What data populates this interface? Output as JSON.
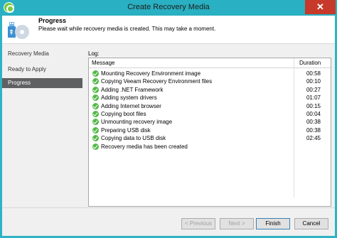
{
  "window": {
    "title": "Create Recovery Media",
    "close_glyph": "✕"
  },
  "header": {
    "title": "Progress",
    "subtitle": "Please wait while recovery media is created. This may take a moment."
  },
  "nav": {
    "items": [
      {
        "label": "Recovery Media",
        "active": false
      },
      {
        "label": "Ready to Apply",
        "active": false
      },
      {
        "label": "Progress",
        "active": true
      }
    ]
  },
  "log": {
    "label": "Log:",
    "columns": {
      "message": "Message",
      "duration": "Duration"
    },
    "rows": [
      {
        "message": "Mounting Recovery Environment image",
        "duration": "00:58"
      },
      {
        "message": "Copying Veeam Recovery Environment files",
        "duration": "00:10"
      },
      {
        "message": "Adding .NET Framework",
        "duration": "00:27"
      },
      {
        "message": "Adding system drivers",
        "duration": "01:07"
      },
      {
        "message": "Adding Internet browser",
        "duration": "00:15"
      },
      {
        "message": "Copying boot files",
        "duration": "00:04"
      },
      {
        "message": "Unmounting recovery image",
        "duration": "00:38"
      },
      {
        "message": "Preparing USB disk",
        "duration": "00:38"
      },
      {
        "message": "Copying data to USB disk",
        "duration": "02:45"
      },
      {
        "message": "Recovery media has been created",
        "duration": ""
      }
    ]
  },
  "footer": {
    "previous": "< Previous",
    "next": "Next >",
    "finish": "Finish",
    "cancel": "Cancel"
  },
  "colors": {
    "titlebar": "#29b0c2",
    "nav_active": "#5e6061",
    "status_ok": "#54b948",
    "close": "#c7392a"
  },
  "icons": {
    "status": "check-circle-icon",
    "header": "usb-drive-icon",
    "app": "veeam-icon"
  }
}
